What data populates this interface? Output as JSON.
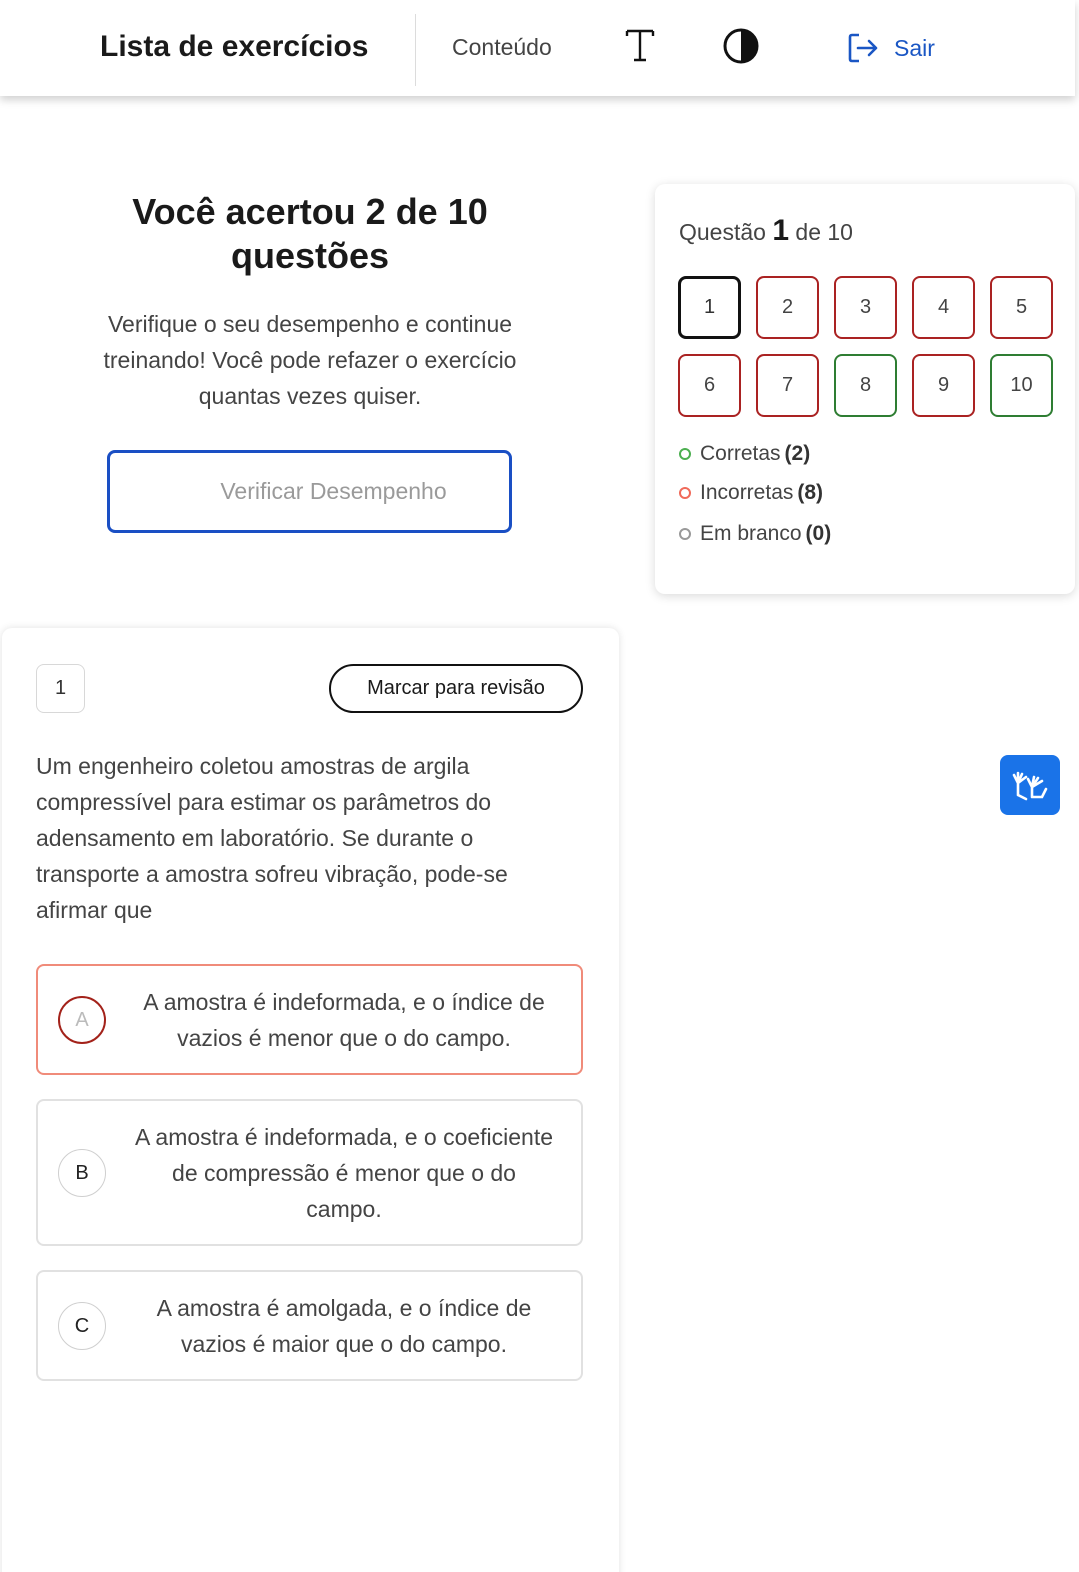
{
  "header": {
    "title": "Lista de exercícios",
    "nav_content": "Conteúdo",
    "font_icon": "text-size-icon",
    "contrast_icon": "contrast-icon",
    "logout_label": "Sair",
    "logout_icon": "logout-icon",
    "accent_color": "#1a56c4"
  },
  "result": {
    "title": "Você acertou 2 de 10 questões",
    "description": "Verifique o seu desempenho e continue treinando! Você pode refazer o exercício quantas vezes quiser.",
    "verify_button": "Verificar Desempenho"
  },
  "navigator": {
    "label_prefix": "Questão",
    "current": "1",
    "label_suffix": "de 10",
    "questions": [
      {
        "num": "1",
        "status": "current"
      },
      {
        "num": "2",
        "status": "incorrect"
      },
      {
        "num": "3",
        "status": "incorrect"
      },
      {
        "num": "4",
        "status": "incorrect"
      },
      {
        "num": "5",
        "status": "incorrect"
      },
      {
        "num": "6",
        "status": "incorrect"
      },
      {
        "num": "7",
        "status": "incorrect"
      },
      {
        "num": "8",
        "status": "correct"
      },
      {
        "num": "9",
        "status": "incorrect"
      },
      {
        "num": "10",
        "status": "correct"
      }
    ],
    "legend": [
      {
        "label": "Corretas",
        "count": "(2)",
        "color": "#4caf50"
      },
      {
        "label": "Incorretas",
        "count": "(8)",
        "color": "#f06a5a"
      },
      {
        "label": "Em branco",
        "count": "(0)",
        "color": "#999999"
      }
    ],
    "colors": {
      "correct": "#2e7d32",
      "incorrect": "#aa2222",
      "current": "#111111"
    }
  },
  "question": {
    "number": "1",
    "review_button": "Marcar para revisão",
    "text": "Um engenheiro coletou amostras de argila compressível para estimar os parâmetros do adensamento em laboratório. Se durante o transporte a amostra sofreu vibração, pode-se afirmar que",
    "options": [
      {
        "letter": "A",
        "text": "A amostra é indeformada, e o índice de vazios é menor que o do campo.",
        "state": "wrong"
      },
      {
        "letter": "B",
        "text": "A amostra é indeformada, e o coeficiente de compressão é menor que o do campo.",
        "state": "normal"
      },
      {
        "letter": "C",
        "text": "A amostra é amolgada, e o índice de vazios é maior que o do campo.",
        "state": "normal"
      }
    ]
  },
  "widgets": {
    "libras_icon": "sign-language-hands-icon",
    "libras_color": "#1a73e8"
  }
}
